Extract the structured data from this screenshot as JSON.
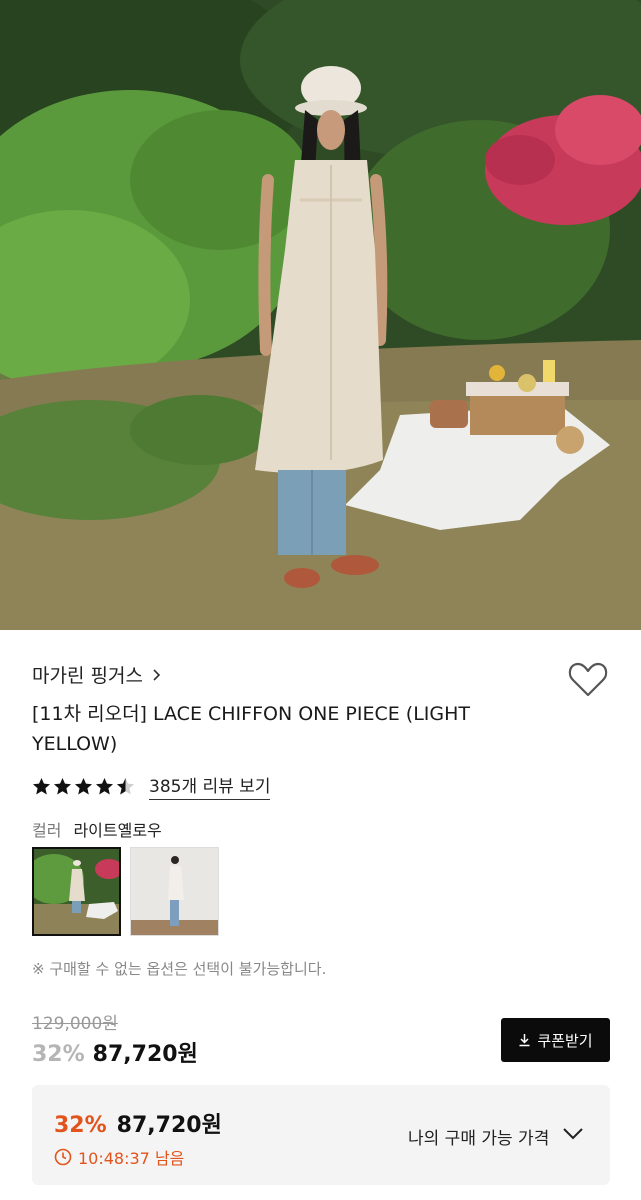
{
  "brand": {
    "name": "마가린 핑거스"
  },
  "product": {
    "title": "[11차 리오더] LACE CHIFFON ONE PIECE (LIGHT YELLOW)",
    "rating": 4.5,
    "review_link": "385개 리뷰 보기"
  },
  "options": {
    "color_label": "컬러",
    "color_value": "라이트옐로우"
  },
  "notice": "※ 구매할 수 없는 옵션은 선택이 불가능합니다.",
  "price": {
    "original": "129,000원",
    "discount": "32%",
    "sale": "87,720원",
    "coupon_button": "쿠폰받기"
  },
  "my_price": {
    "discount": "32%",
    "price": "87,720원",
    "timer": "10:48:37 남음",
    "label": "나의 구매 가능 가격"
  },
  "colors": {
    "accent": "#e2541c",
    "button_bg": "#0b0b0b"
  }
}
